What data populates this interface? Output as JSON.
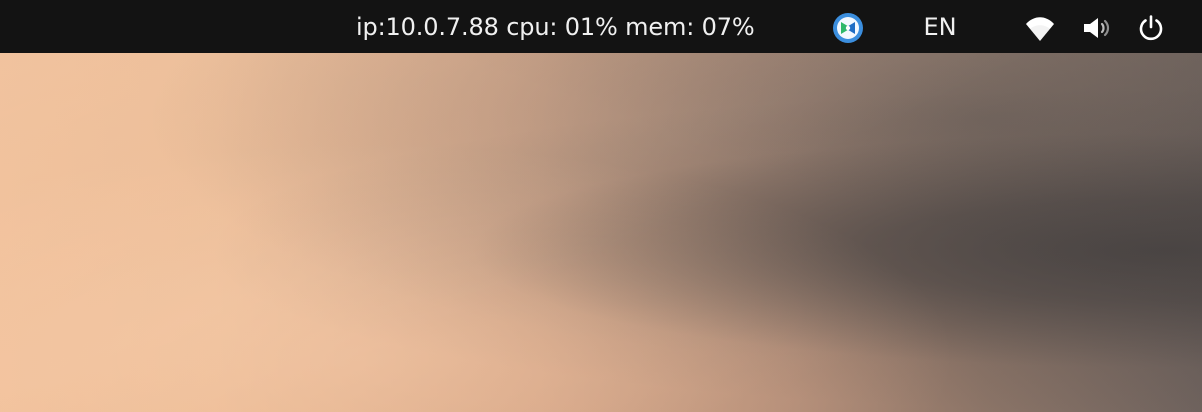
{
  "topbar": {
    "system_stats": {
      "ip": "ip:10.0.7.88",
      "cpu": "cpu: 01%",
      "mem": "mem: 07%"
    },
    "tray_app_icon": "remote-desktop-icon",
    "language": "EN",
    "icons": {
      "wifi": "wifi-icon",
      "volume": "volume-icon",
      "power": "power-icon"
    }
  },
  "colors": {
    "panel_background": "#131313",
    "panel_text": "#f0f0f0",
    "tray_icon_blue": "#3b8ede",
    "tray_icon_green": "#2fb86a"
  }
}
